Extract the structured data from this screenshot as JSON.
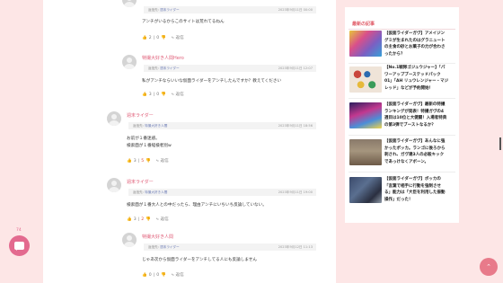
{
  "comments": [
    {
      "name": "",
      "reply_label": "返信先:",
      "reply_to": "週末ライダー",
      "time": "2023年9月11日 00:00",
      "text": [
        "アンチがいるからこのサイトは荒れてるねん"
      ],
      "up": "2",
      "down": "0",
      "reply": "返信"
    },
    {
      "name": "特撮大好き人間Hero",
      "reply_label": "返信先:",
      "reply_to": "週末ライダー",
      "time": "2023年9月11日 12:07",
      "text": [
        "私がアンチならいいな仮面ライダーをアンチしたんですか？教えてください"
      ],
      "up": "3",
      "down": "0",
      "reply": "返信"
    },
    {
      "name": "週末ライダー",
      "reply_label": "返信先:",
      "reply_to": "特撮大好き人間",
      "time": "2023年9月11日 18:56",
      "text": [
        "お前が１番迷惑。",
        "検索面が１番経検者別w"
      ],
      "up": "3",
      "down": "5",
      "reply": "返信"
    },
    {
      "name": "週末ライダー",
      "reply_label": "返信先:",
      "reply_to": "特撮大好き人間",
      "time": "2023年9月11日 19:00",
      "text": [
        "検索面が１番大人との中だったら、理由アンチにいちいち反論していない。"
      ],
      "up": "3",
      "down": "2",
      "reply": "返信"
    },
    {
      "name": "特撮大好き人間",
      "reply_label": "返信先:",
      "reply_to": "週末ライダー",
      "time": "2023年9月12日 11:13",
      "text": [
        "じゃあ次から仮面ライダーをアンチしてる人にも反論しません"
      ],
      "up": "0",
      "down": "0",
      "reply": "返信"
    }
  ],
  "sidebar": {
    "title": "最新の記事",
    "articles": [
      {
        "lines": [
          "【仮面ライダーガヴ】アメイジン",
          "グミが生まれたのはグラニュート",
          "の主食の砂とお菓子の力が合わさ",
          "ったから？"
        ]
      },
      {
        "lines": [
          "【No.1戦隊ゴジュウジャー】「パ",
          "ワーアップブーステッドパック",
          "01」「AH リュウレンジャー・マジ",
          "レッド」などが予約開始！"
        ]
      },
      {
        "lines": [
          "【仮面ライダーガヴ】最新の特撮",
          "ランキングが発表！特撮ガヴの4",
          "週目は10位と大健闘！入場者特典",
          "の第3弾でブーストなるか？"
        ]
      },
      {
        "lines": [
          "【仮面ライダーガヴ】あんなに強",
          "かったポッカ。ランゴに後ろから",
          "刺され、ガヴ達3人の必殺キック",
          "であっけなくアボーン。"
        ]
      },
      {
        "lines": [
          "【仮面ライダーガヴ】ボッカの",
          "「言葉で相手に行動を強制させ",
          "る」能力は「大臣を利用した振動",
          "操作」だった！"
        ]
      }
    ]
  },
  "fab_badge": "74",
  "scroll_top_icon": "chevron-up-icon",
  "colors": {
    "accent": "#e36a8f",
    "name": "#e0607a",
    "upvote": "#1e6fa8",
    "downvote": "#d84a3b",
    "page_bg": "#fde6e6"
  }
}
